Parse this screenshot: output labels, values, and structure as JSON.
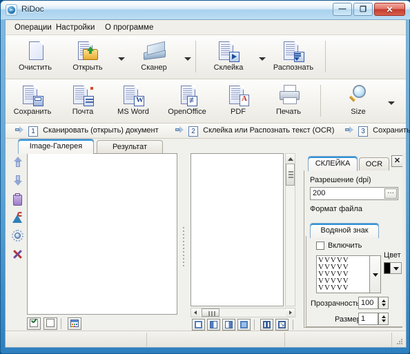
{
  "window": {
    "title": "RiDoc",
    "app_icon": "ridoc-disc-icon",
    "minimize_label": "—",
    "maximize_label": "❐",
    "close_label": "✕"
  },
  "menubar": {
    "items": [
      {
        "label": "Операции",
        "name": "menu-operations"
      },
      {
        "label": "Настройки",
        "name": "menu-settings"
      },
      {
        "label": "О программе",
        "name": "menu-about"
      }
    ]
  },
  "toolbar_top": {
    "buttons": [
      {
        "label": "Очистить",
        "icon": "blank-page-icon",
        "dropdown": false
      },
      {
        "label": "Открыть",
        "icon": "open-folder-icon",
        "dropdown": true
      },
      {
        "label": "Сканер",
        "icon": "scanner-icon",
        "dropdown": true
      },
      {
        "label": "Склейка",
        "icon": "merge-play-icon",
        "dropdown": true
      },
      {
        "label": "Распознать",
        "icon": "ocr-recognize-icon",
        "dropdown": false
      }
    ]
  },
  "toolbar_bottom": {
    "buttons": [
      {
        "label": "Сохранить",
        "icon": "save-floppy-icon",
        "dropdown": false
      },
      {
        "label": "Почта",
        "icon": "mail-icon",
        "dropdown": false
      },
      {
        "label": "MS Word",
        "icon": "ms-word-icon",
        "dropdown": false
      },
      {
        "label": "OpenOffice",
        "icon": "openoffice-icon",
        "dropdown": false
      },
      {
        "label": "PDF",
        "icon": "pdf-icon",
        "dropdown": false
      },
      {
        "label": "Печать",
        "icon": "printer-icon",
        "dropdown": false
      },
      {
        "label": "Size",
        "icon": "magnifier-icon",
        "dropdown": true
      }
    ]
  },
  "steps": [
    {
      "number": "1",
      "label": "Сканировать (открыть) документ"
    },
    {
      "number": "2",
      "label": "Склейка или Распознать текст (OCR)"
    },
    {
      "number": "3",
      "label": "Сохранить"
    }
  ],
  "main_tabs": [
    {
      "label": "Image-Галерея",
      "active": true
    },
    {
      "label": "Результат",
      "active": false
    }
  ],
  "gallery": {
    "vertical_tools": [
      {
        "icon": "arrow-up-icon",
        "name": "move-up-button"
      },
      {
        "icon": "arrow-down-icon",
        "name": "move-down-button"
      },
      {
        "icon": "clipboard-icon",
        "name": "clipboard-button"
      },
      {
        "icon": "rotate-icon",
        "name": "rotate-button"
      },
      {
        "icon": "brightness-icon",
        "name": "brightness-button"
      },
      {
        "icon": "delete-x-icon",
        "name": "delete-button"
      }
    ],
    "bottom_buttons": [
      {
        "icon": "check-all-icon",
        "name": "select-all-button"
      },
      {
        "icon": "deselect-all-icon",
        "name": "deselect-all-button"
      },
      {
        "icon": "thumbnails-icon",
        "name": "thumbnail-view-button"
      }
    ]
  },
  "preview": {
    "bottom_buttons": [
      {
        "icon": "fit-page-icon",
        "name": "fit-page-button"
      },
      {
        "icon": "split-left-icon",
        "name": "split-left-button"
      },
      {
        "icon": "split-right-icon",
        "name": "split-right-button"
      },
      {
        "icon": "fit-width-icon",
        "name": "fit-width-button"
      },
      {
        "icon": "page-left-icon",
        "name": "page-left-button"
      },
      {
        "icon": "page-right-icon",
        "name": "page-right-button"
      }
    ],
    "hscroll_left_arrow": "◀",
    "hscroll_right_arrow": "▶",
    "vscroll_up_arrow": "▲"
  },
  "settings_panel": {
    "tabs": [
      {
        "label": "СКЛЕЙКА",
        "active": true
      },
      {
        "label": "OCR",
        "active": false
      }
    ],
    "close_label": "✕",
    "resolution_label": "Разрешение (dpi)",
    "resolution_value": "200",
    "resolution_browse_label": "···",
    "file_format_label": "Формат файла",
    "watermark": {
      "tab_label": "Водяной знак",
      "enable_label": "Включить",
      "enable_checked": false,
      "preview_text": "VVVVV\nVVVVV\nVVVVV\nVVVVV\nVVVVV",
      "color_label": "Цвет",
      "color_value": "#000000",
      "transparency_label": "Прозрачность",
      "transparency_value": "100",
      "size_label": "Размер",
      "size_value": "1"
    }
  },
  "statusbar": {
    "cells": [
      "",
      "",
      "",
      ""
    ]
  }
}
